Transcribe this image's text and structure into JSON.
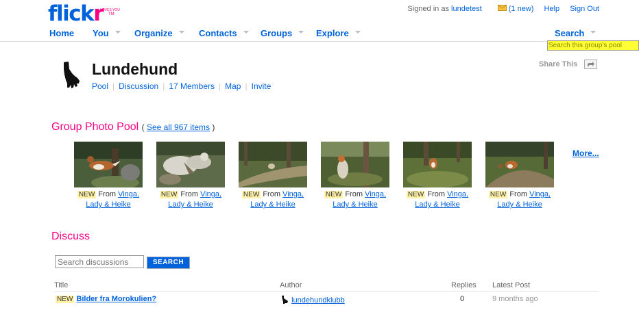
{
  "header": {
    "logo": {
      "flick": "flick",
      "r": "r",
      "tagline": "LOVES YOU",
      "tm": "TM"
    },
    "signed_in_prefix": "Signed in as",
    "username": "lundetest",
    "mail_count": "(1 new)",
    "help": "Help",
    "sign_out": "Sign Out"
  },
  "nav": {
    "items": [
      {
        "label": "Home"
      },
      {
        "label": "You"
      },
      {
        "label": "Organize"
      },
      {
        "label": "Contacts"
      },
      {
        "label": "Groups"
      },
      {
        "label": "Explore"
      }
    ],
    "search_label": "Search",
    "search_hint": "Search this group's pool"
  },
  "group": {
    "name": "Lundehund",
    "links": [
      "Pool",
      "Discussion",
      "17 Members",
      "Map",
      "Invite"
    ],
    "share_label": "Share This"
  },
  "pool": {
    "heading": "Group Photo Pool",
    "see_all_open": "(",
    "see_all": "See all 967 items",
    "see_all_close": ")",
    "more": "More...",
    "photos": [
      {
        "badge": "NEW",
        "from": "From",
        "owner_line1": "Vinga,",
        "owner_line2": "Lady & Heike"
      },
      {
        "badge": "NEW",
        "from": "From",
        "owner_line1": "Vinga,",
        "owner_line2": "Lady & Heike"
      },
      {
        "badge": "NEW",
        "from": "From",
        "owner_line1": "Vinga,",
        "owner_line2": "Lady & Heike"
      },
      {
        "badge": "NEW",
        "from": "From",
        "owner_line1": "Vinga,",
        "owner_line2": "Lady & Heike"
      },
      {
        "badge": "NEW",
        "from": "From",
        "owner_line1": "Vinga,",
        "owner_line2": "Lady & Heike"
      },
      {
        "badge": "NEW",
        "from": "From",
        "owner_line1": "Vinga,",
        "owner_line2": "Lady & Heike"
      }
    ]
  },
  "discuss": {
    "heading": "Discuss",
    "search_placeholder": "Search discussions",
    "search_button": "SEARCH",
    "columns": {
      "title": "Title",
      "author": "Author",
      "replies": "Replies",
      "latest": "Latest Post"
    },
    "rows": [
      {
        "badge": "NEW",
        "title": "Bilder fra Morokulien?",
        "author": "lundehundklubb",
        "replies": "0",
        "latest": "9 months ago"
      }
    ]
  },
  "colors": {
    "brand_blue": "#0063dc",
    "brand_pink": "#ff0084",
    "hint_yellow": "#ffff33",
    "new_badge": "#fff2a8"
  }
}
